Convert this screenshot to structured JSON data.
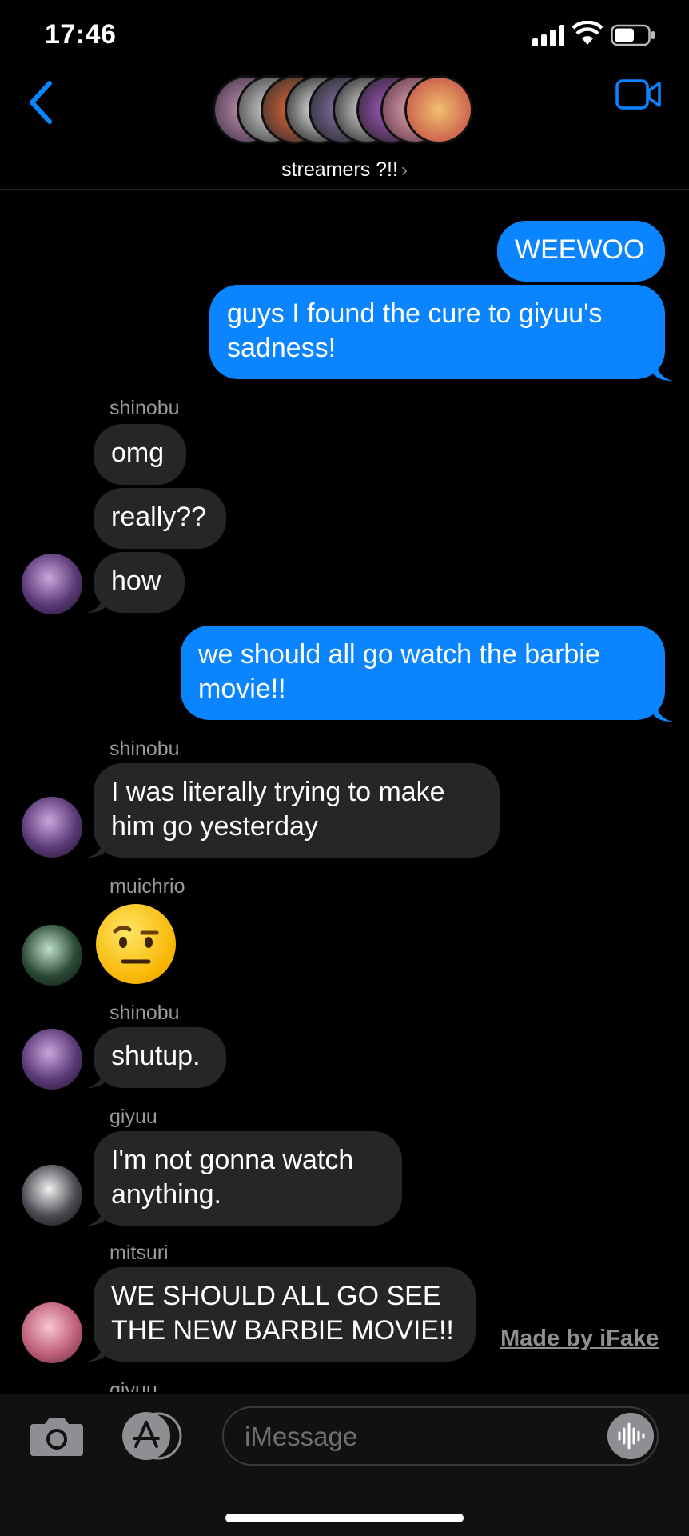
{
  "status": {
    "time": "17:46"
  },
  "header": {
    "group_name": "streamers ?!!"
  },
  "messages": [
    {
      "text": "WEEWOO"
    },
    {
      "text": "guys I found the cure to giyuu's sadness!"
    },
    {
      "sender": "shinobu"
    },
    {
      "text": "omg"
    },
    {
      "text": "really??"
    },
    {
      "text": "how"
    },
    {
      "text": "we should all go watch the barbie movie!!"
    },
    {
      "sender": "shinobu"
    },
    {
      "text": "I was literally trying to make him go yesterday"
    },
    {
      "sender": "muichrio"
    },
    {
      "emoji": "raised-eyebrow-face"
    },
    {
      "sender": "shinobu"
    },
    {
      "text": "shutup."
    },
    {
      "sender": "giyuu"
    },
    {
      "text": "I'm not gonna watch anything."
    },
    {
      "sender": "mitsuri"
    },
    {
      "text": "WE SHOULD ALL GO SEE THE NEW BARBIE MOVIE!!"
    },
    {
      "sender": "giyuu"
    }
  ],
  "watermark": "Made by iFake",
  "composer": {
    "placeholder": "iMessage"
  },
  "colors": {
    "accent": "#0a84ff",
    "incoming": "#262628",
    "background": "#000000"
  }
}
